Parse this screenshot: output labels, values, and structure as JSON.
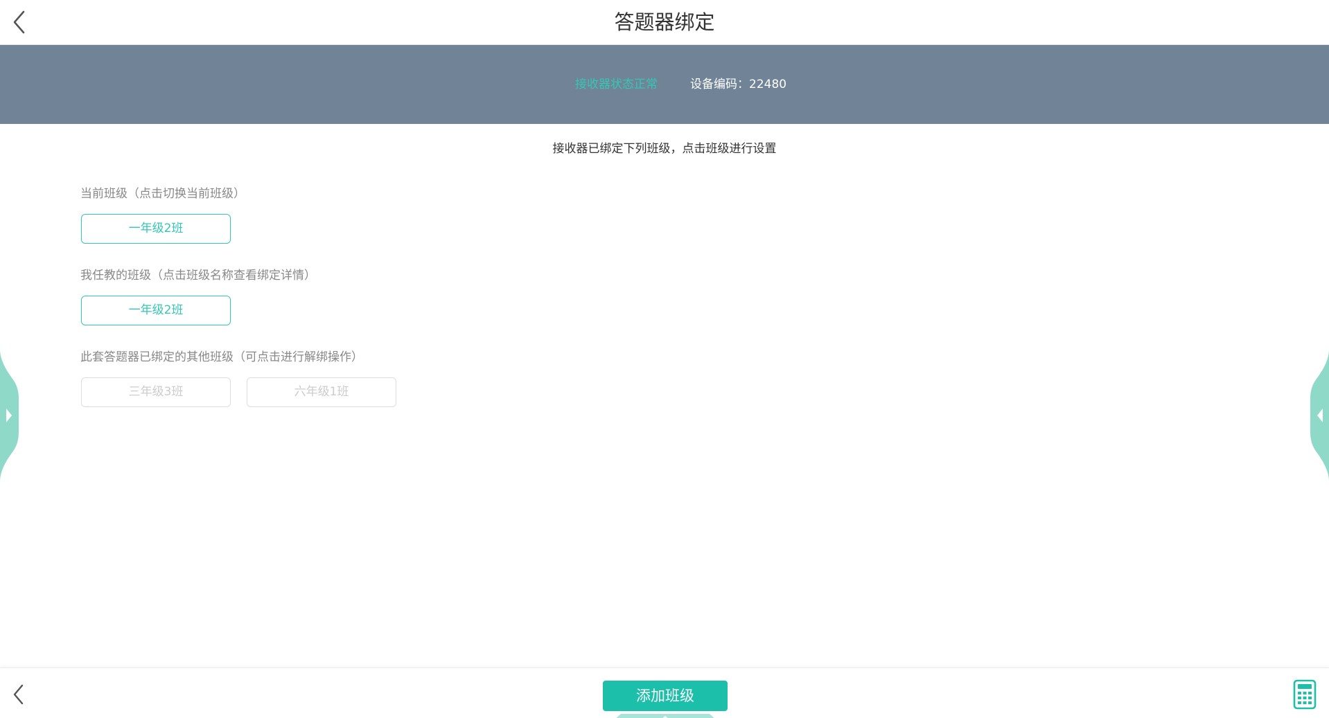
{
  "header": {
    "title": "答题器绑定"
  },
  "status": {
    "receiver_status": "接收器状态正常",
    "device_code_label": "设备编码：22480"
  },
  "main": {
    "hint": "接收器已绑定下列班级，点击班级进行设置",
    "current_class": {
      "label": "当前班级（点击切换当前班级）",
      "classes": [
        "一年级2班"
      ]
    },
    "my_classes": {
      "label": "我任教的班级（点击班级名称查看绑定详情）",
      "classes": [
        "一年级2班"
      ]
    },
    "other_classes": {
      "label": "此套答题器已绑定的其他班级（可点击进行解绑操作）",
      "classes": [
        "三年级3班",
        "六年级1班"
      ]
    }
  },
  "bottom_bar": {
    "add_class_label": "添加班级"
  },
  "colors": {
    "accent": "#35c6b5",
    "button_fill": "#1cbfaa",
    "banner": "#718397",
    "side_tab": "#8fd9c9"
  },
  "icons": {
    "back": "chevron-left-icon",
    "calculator": "calculator-icon",
    "side_left": "caret-right-icon",
    "side_right": "caret-left-icon",
    "drawer": "caret-up-icon"
  }
}
